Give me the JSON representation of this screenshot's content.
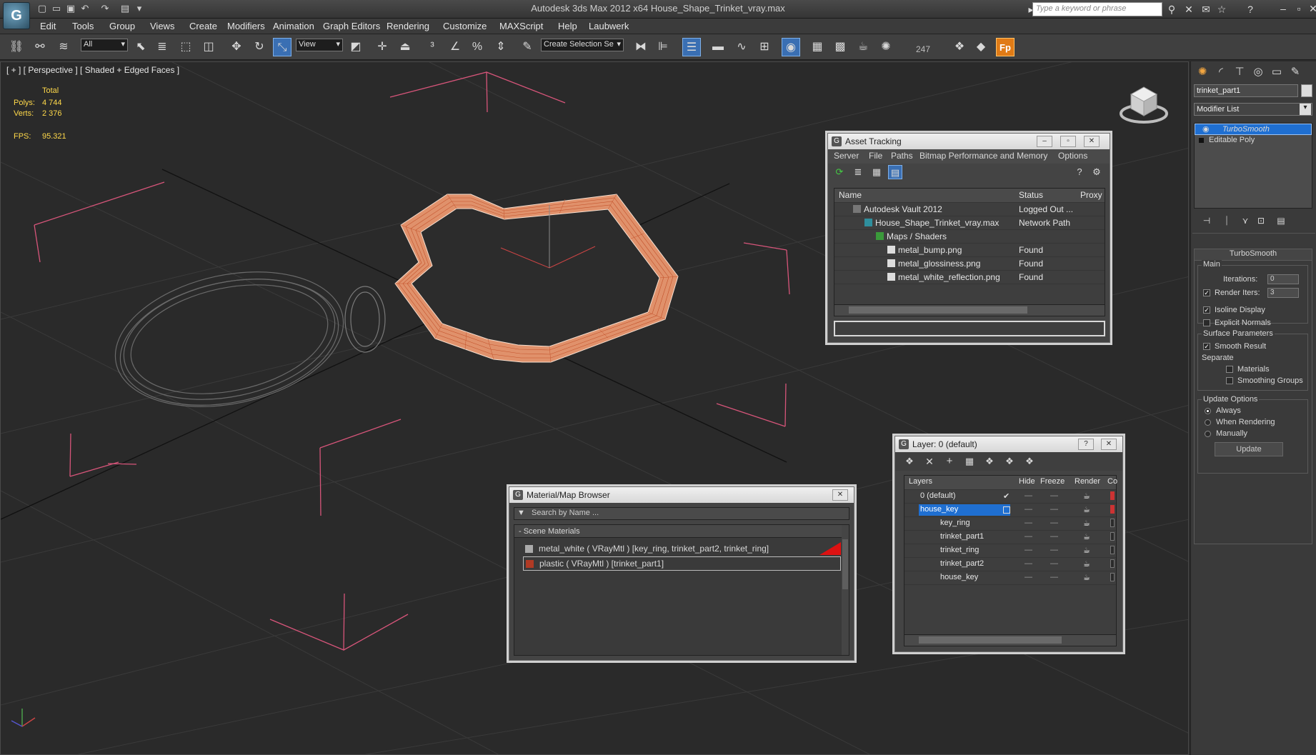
{
  "title_bar": {
    "title": "Autodesk 3ds Max  2012 x64       House_Shape_Trinket_vray.max",
    "search_placeholder": "Type a keyword or phrase",
    "app_logo": "G"
  },
  "menu": [
    "Edit",
    "Tools",
    "Group",
    "Views",
    "Create",
    "Modifiers",
    "Animation",
    "Graph Editors",
    "Rendering",
    "Customize",
    "MAXScript",
    "Help",
    "Laubwerk"
  ],
  "toolbar": {
    "selection_filter": "All",
    "reference_coord": "View",
    "named_selection": "Create Selection Se",
    "frame_count": "247"
  },
  "viewport": {
    "label": "[ + ] [ Perspective ] [ Shaded + Edged Faces ]",
    "stats": {
      "header": "Total",
      "polys_label": "Polys:",
      "polys_value": "4 744",
      "verts_label": "Verts:",
      "verts_value": "2 376",
      "fps_label": "FPS:",
      "fps_value": "95.321"
    }
  },
  "asset_tracking": {
    "title": "Asset Tracking",
    "menu": [
      "Server",
      "File",
      "Paths",
      "Bitmap Performance and Memory",
      "Options"
    ],
    "columns": [
      "Name",
      "Status",
      "Proxy"
    ],
    "rows": [
      {
        "name": "Autodesk Vault 2012",
        "status": "Logged Out ..."
      },
      {
        "name": "House_Shape_Trinket_vray.max",
        "status": "Network Path"
      },
      {
        "name": "Maps / Shaders",
        "status": ""
      },
      {
        "name": "metal_bump.png",
        "status": "Found"
      },
      {
        "name": "metal_glossiness.png",
        "status": "Found"
      },
      {
        "name": "metal_white_reflection.png",
        "status": "Found"
      }
    ]
  },
  "material_browser": {
    "title": "Material/Map Browser",
    "search_placeholder": "Search by Name ...",
    "group": "- Scene Materials",
    "materials": [
      {
        "label": "metal_white  ( VRayMtl )  [key_ring, trinket_part2, trinket_ring]"
      },
      {
        "label": "plastic  ( VRayMtl )  [trinket_part1]"
      }
    ]
  },
  "layer_manager": {
    "title": "Layer: 0 (default)",
    "columns": [
      "Layers",
      "Hide",
      "Freeze",
      "Render",
      "Co"
    ],
    "rows": [
      {
        "name": "0 (default)",
        "level": 0
      },
      {
        "name": "house_key",
        "level": 0
      },
      {
        "name": "key_ring",
        "level": 1
      },
      {
        "name": "trinket_part1",
        "level": 1
      },
      {
        "name": "trinket_ring",
        "level": 1
      },
      {
        "name": "trinket_part2",
        "level": 1
      },
      {
        "name": "house_key",
        "level": 1
      }
    ]
  },
  "command_panel": {
    "object_name": "trinket_part1",
    "modifier_list": "Modifier List",
    "stack": [
      "TurboSmooth",
      "Editable Poly"
    ],
    "rollout_title": "TurboSmooth",
    "main_group": "Main",
    "iterations_label": "Iterations:",
    "iterations_value": "0",
    "render_iters_label": "Render Iters:",
    "render_iters_value": "3",
    "isoline_label": "Isoline Display",
    "explicit_label": "Explicit Normals",
    "surface_group": "Surface Parameters",
    "smooth_result_label": "Smooth Result",
    "separate_label": "Separate",
    "materials_label": "Materials",
    "smoothing_groups_label": "Smoothing Groups",
    "update_group": "Update Options",
    "always_label": "Always",
    "when_rendering_label": "When Rendering",
    "manually_label": "Manually",
    "update_button": "Update"
  },
  "colors": {
    "selection_wire": "#e86a3c",
    "bracket": "#d7557a",
    "highlight": "#1f6fd1"
  }
}
